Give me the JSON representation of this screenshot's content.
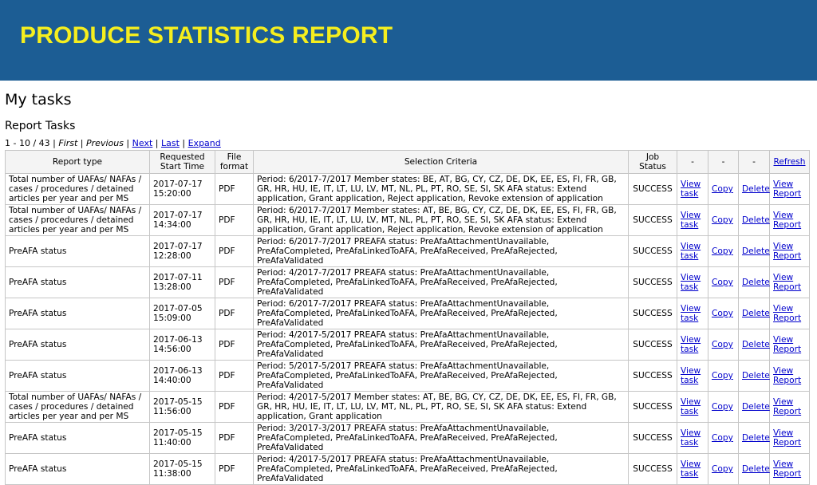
{
  "banner": {
    "title": "PRODUCE STATISTICS REPORT"
  },
  "page": {
    "title": "My tasks",
    "section_title": "Report Tasks"
  },
  "pager": {
    "range": "1 - 10 / 43",
    "first": "First",
    "previous": "Previous",
    "next": "Next",
    "last": "Last",
    "expand": "Expand"
  },
  "table": {
    "headers": {
      "report_type": "Report type",
      "requested_start": "Requested Start Time",
      "file_format": "File format",
      "selection_criteria": "Selection Criteria",
      "job_status": "Job Status",
      "col1": "-",
      "col2": "-",
      "col3": "-",
      "refresh": "Refresh"
    },
    "action_labels": {
      "view_task": "View task",
      "copy": "Copy",
      "delete": "Delete",
      "view_report": "View Report"
    },
    "rows": [
      {
        "report_type": "Total number of UAFAs/ NAFAs / cases / procedures / detained articles per year and per MS",
        "date": "2017-07-17",
        "time": "15:20:00",
        "format": "PDF",
        "criteria": "Period: 6/2017-7/2017 Member states: BE, AT, BG, CY, CZ, DE, DK, EE, ES, FI, FR, GB, GR, HR, HU, IE, IT, LT, LU, LV, MT, NL, PL, PT, RO, SE, SI, SK AFA status: Extend application, Grant application, Reject application, Revoke extension of application",
        "status": "SUCCESS"
      },
      {
        "report_type": "Total number of UAFAs/ NAFAs / cases / procedures / detained articles per year and per MS",
        "date": "2017-07-17",
        "time": "14:34:00",
        "format": "PDF",
        "criteria": "Period: 6/2017-7/2017 Member states: AT, BE, BG, CY, CZ, DE, DK, EE, ES, FI, FR, GB, GR, HR, HU, IE, IT, LT, LU, LV, MT, NL, PL, PT, RO, SE, SI, SK AFA status: Extend application, Grant application, Reject application, Revoke extension of application",
        "status": "SUCCESS"
      },
      {
        "report_type": "PreAFA status",
        "date": "2017-07-17",
        "time": "12:28:00",
        "format": "PDF",
        "criteria": "Period: 6/2017-7/2017 PREAFA status: PreAfaAttachmentUnavailable, PreAfaCompleted, PreAfaLinkedToAFA, PreAfaReceived, PreAfaRejected, PreAfaValidated",
        "status": "SUCCESS"
      },
      {
        "report_type": "PreAFA status",
        "date": "2017-07-11",
        "time": "13:28:00",
        "format": "PDF",
        "criteria": "Period: 4/2017-7/2017 PREAFA status: PreAfaAttachmentUnavailable, PreAfaCompleted, PreAfaLinkedToAFA, PreAfaReceived, PreAfaRejected, PreAfaValidated",
        "status": "SUCCESS"
      },
      {
        "report_type": "PreAFA status",
        "date": "2017-07-05",
        "time": "15:09:00",
        "format": "PDF",
        "criteria": "Period: 6/2017-7/2017 PREAFA status: PreAfaAttachmentUnavailable, PreAfaCompleted, PreAfaLinkedToAFA, PreAfaReceived, PreAfaRejected, PreAfaValidated",
        "status": "SUCCESS"
      },
      {
        "report_type": "PreAFA status",
        "date": "2017-06-13",
        "time": "14:56:00",
        "format": "PDF",
        "criteria": "Period: 4/2017-5/2017 PREAFA status: PreAfaAttachmentUnavailable, PreAfaCompleted, PreAfaLinkedToAFA, PreAfaReceived, PreAfaRejected, PreAfaValidated",
        "status": "SUCCESS"
      },
      {
        "report_type": "PreAFA status",
        "date": "2017-06-13",
        "time": "14:40:00",
        "format": "PDF",
        "criteria": "Period: 5/2017-5/2017 PREAFA status: PreAfaAttachmentUnavailable, PreAfaCompleted, PreAfaLinkedToAFA, PreAfaReceived, PreAfaRejected, PreAfaValidated",
        "status": "SUCCESS"
      },
      {
        "report_type": "Total number of UAFAs/ NAFAs / cases / procedures / detained articles per year and per MS",
        "date": "2017-05-15",
        "time": "11:56:00",
        "format": "PDF",
        "criteria": "Period: 4/2017-5/2017 Member states: AT, BE, BG, CY, CZ, DE, DK, EE, ES, FI, FR, GB, GR, HR, HU, IE, IT, LT, LU, LV, MT, NL, PL, PT, RO, SE, SI, SK AFA status: Extend application, Grant application",
        "status": "SUCCESS"
      },
      {
        "report_type": "PreAFA status",
        "date": "2017-05-15",
        "time": "11:40:00",
        "format": "PDF",
        "criteria": "Period: 3/2017-3/2017 PREAFA status: PreAfaAttachmentUnavailable, PreAfaCompleted, PreAfaLinkedToAFA, PreAfaReceived, PreAfaRejected, PreAfaValidated",
        "status": "SUCCESS"
      },
      {
        "report_type": "PreAFA status",
        "date": "2017-05-15",
        "time": "11:38:00",
        "format": "PDF",
        "criteria": "Period: 4/2017-5/2017 PREAFA status: PreAfaAttachmentUnavailable, PreAfaCompleted, PreAfaLinkedToAFA, PreAfaReceived, PreAfaRejected, PreAfaValidated",
        "status": "SUCCESS"
      }
    ]
  }
}
